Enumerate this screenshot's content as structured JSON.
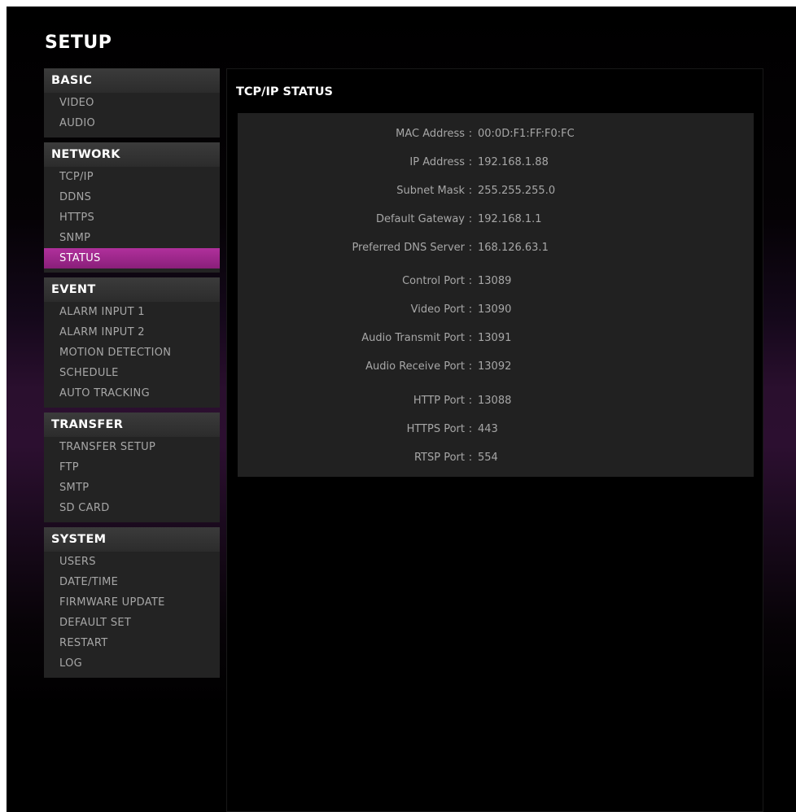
{
  "page": {
    "title": "SETUP"
  },
  "sidebar": {
    "groups": [
      {
        "title": "BASIC",
        "items": [
          "VIDEO",
          "AUDIO"
        ]
      },
      {
        "title": "NETWORK",
        "items": [
          "TCP/IP",
          "DDNS",
          "HTTPS",
          "SNMP",
          "STATUS"
        ]
      },
      {
        "title": "EVENT",
        "items": [
          "ALARM INPUT 1",
          "ALARM INPUT 2",
          "MOTION DETECTION",
          "SCHEDULE",
          "AUTO TRACKING"
        ]
      },
      {
        "title": "TRANSFER",
        "items": [
          "TRANSFER SETUP",
          "FTP",
          "SMTP",
          "SD CARD"
        ]
      },
      {
        "title": "SYSTEM",
        "items": [
          "USERS",
          "DATE/TIME",
          "FIRMWARE UPDATE",
          "DEFAULT SET",
          "RESTART",
          "LOG"
        ]
      }
    ],
    "active_item": "STATUS"
  },
  "main": {
    "section_title": "TCP/IP STATUS",
    "separator": ":",
    "rows": [
      {
        "label": "MAC Address",
        "value": "00:0D:F1:FF:F0:FC"
      },
      {
        "label": "IP Address",
        "value": "192.168.1.88"
      },
      {
        "label": "Subnet Mask",
        "value": "255.255.255.0"
      },
      {
        "label": "Default Gateway",
        "value": "192.168.1.1"
      },
      {
        "label": "Preferred DNS Server",
        "value": "168.126.63.1"
      },
      {
        "label": "Control Port",
        "value": "13089"
      },
      {
        "label": "Video Port",
        "value": "13090"
      },
      {
        "label": "Audio Transmit Port",
        "value": "13091"
      },
      {
        "label": "Audio Receive Port",
        "value": "13092"
      },
      {
        "label": "HTTP Port",
        "value": "13088"
      },
      {
        "label": "HTTPS Port",
        "value": "443"
      },
      {
        "label": "RTSP Port",
        "value": "554"
      }
    ]
  },
  "colors": {
    "accent": "#a2288f",
    "background": "#000000",
    "panel": "#212121",
    "text_muted": "#a7a7a7",
    "text_bright": "#ffffff"
  }
}
